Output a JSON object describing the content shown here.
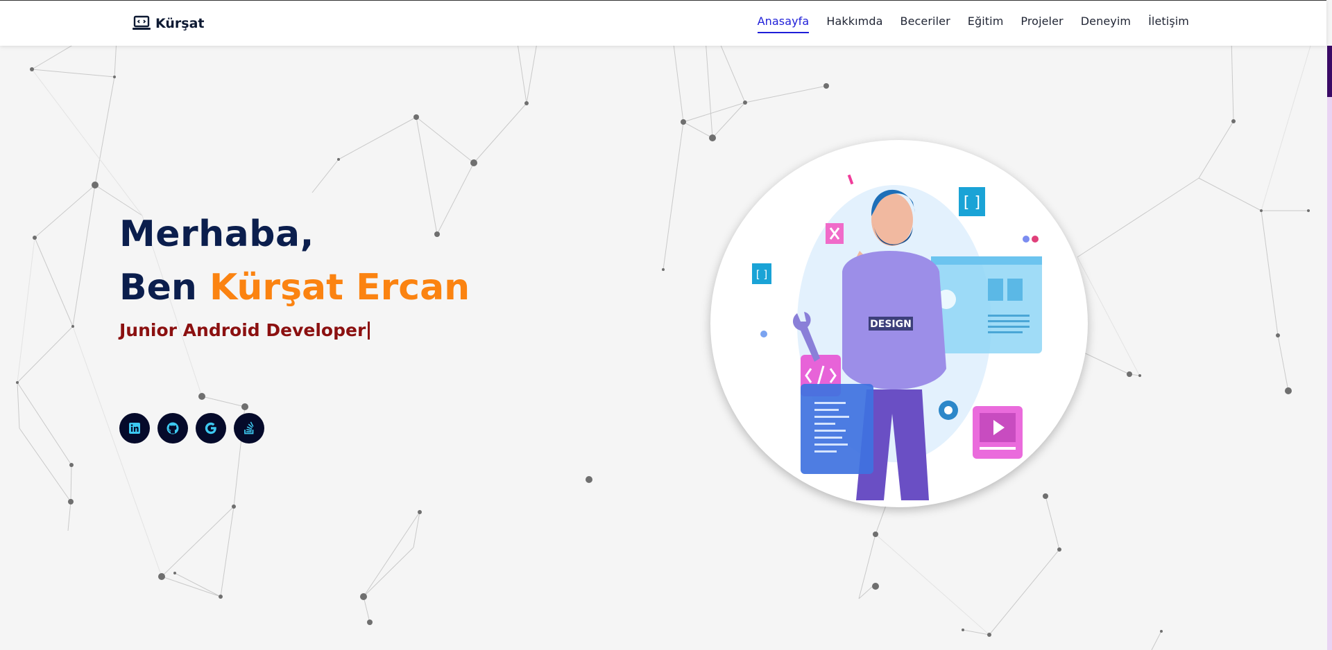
{
  "brand": {
    "name": "Kürşat",
    "icon": "laptop-code-icon"
  },
  "nav": {
    "items": [
      {
        "label": "Anasayfa",
        "active": true
      },
      {
        "label": "Hakkımda",
        "active": false
      },
      {
        "label": "Beceriler",
        "active": false
      },
      {
        "label": "Eğitim",
        "active": false
      },
      {
        "label": "Projeler",
        "active": false
      },
      {
        "label": "Deneyim",
        "active": false
      },
      {
        "label": "İletişim",
        "active": false
      }
    ]
  },
  "hero": {
    "greeting": "Merhaba,",
    "name_prefix": "Ben",
    "name": "Kürşat Ercan",
    "role": "Junior Android Developer"
  },
  "socials": [
    {
      "icon": "linkedin-icon"
    },
    {
      "icon": "github-icon"
    },
    {
      "icon": "google-icon"
    },
    {
      "icon": "stackoverflow-icon"
    }
  ],
  "illustration": {
    "badge_text": "DESIGN",
    "icon": "developer-illustration"
  },
  "colors": {
    "navy": "#0b1e4d",
    "accent_orange": "#fb8311",
    "role_red": "#8b1010",
    "nav_active": "#1e1ed8",
    "social_bg": "#050a2a",
    "social_icon": "#3dc8f0"
  }
}
